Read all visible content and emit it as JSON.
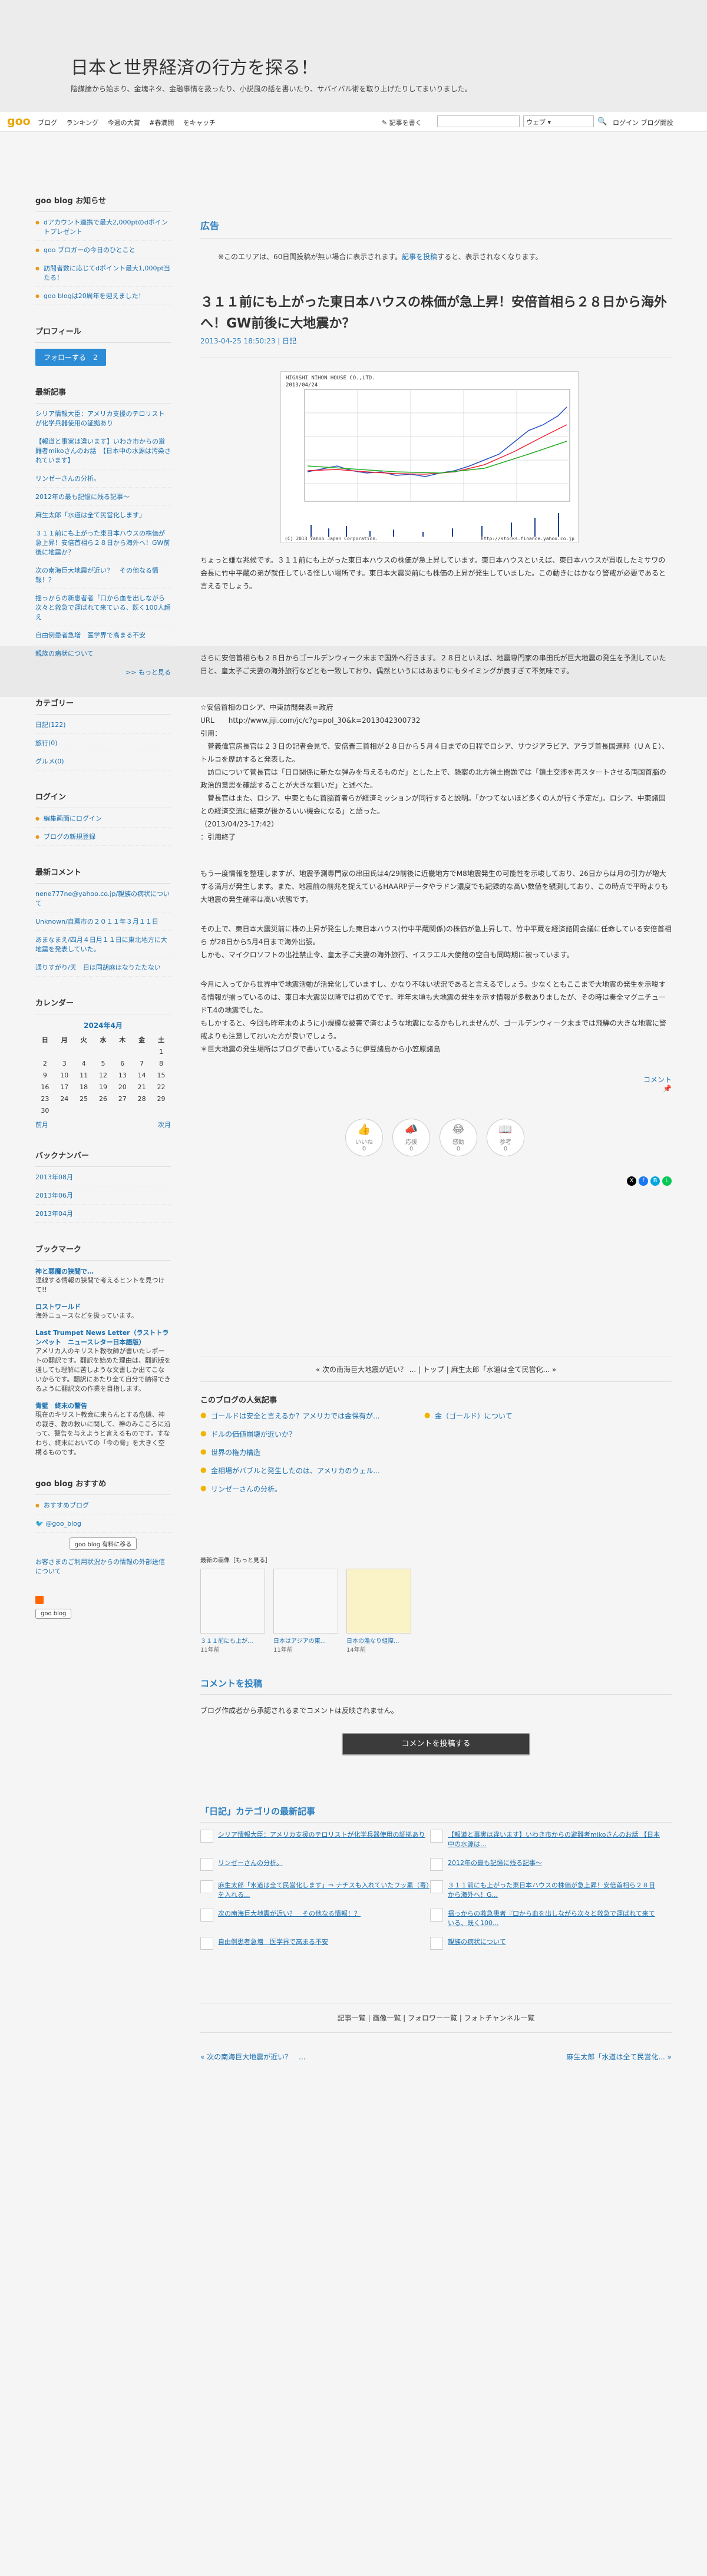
{
  "header": {
    "blog_title": "日本と世界経済の行方を探る！",
    "description": "陰謀論から始まり、金塊ネタ、金融事情を扱ったり、小説風の話を書いたり、サバイバル術を取り上げたりしてまいりました。"
  },
  "topbar": {
    "logo": "goo",
    "links": [
      "ブログ",
      "ランキング",
      "今週の大賞",
      "#春満開",
      "をキャッチ"
    ],
    "write": "記事を書く",
    "search_placeholder": "",
    "search_select": "ウェブ",
    "right_links": [
      "ログイン",
      "ブログ開設"
    ]
  },
  "sidebar": {
    "notice": {
      "title": "goo blog お知らせ",
      "items": [
        "dアカウント連携で最大2,000ptのdポイントプレゼント",
        "goo ブロガーの今日のひとこと",
        "訪問者数に応じてdポイント最大1,000pt当たる！",
        "goo blogは20周年を迎えました！"
      ]
    },
    "profile": {
      "title": "プロフィール",
      "follow": "フォローする",
      "count": "2"
    },
    "recent": {
      "title": "最新記事",
      "items": [
        "シリア情報大臣：アメリカ支援のテロリストが化学兵器使用の証拠あり",
        "【報道と事実は違います】いわき市からの避難者mikoさんのお話　【日本中の水源は汚染されています】",
        "リンゼーさんの分析。",
        "2012年の最も記憶に残る記事～",
        "麻生太郎「水道は全て民営化します」",
        "３１１前にも上がった東日本ハウスの株価が急上昇！安倍首相ら２８日から海外へ！GW前後に地震か？",
        "次の南海巨大地震が近い？　その他なる情報！？",
        "揺っからの新息者者「口から血を出しながら次々と救急で運ばれて来ている、既く100人超え",
        "自由例患者急増　医学界で高まる不安",
        "親族の病状について"
      ],
      "more": ">> もっと見る"
    },
    "category": {
      "title": "カテゴリー",
      "items": [
        "日記(122)",
        "旅行(0)",
        "グルメ(0)"
      ]
    },
    "login": {
      "title": "ログイン",
      "items": [
        "編集画面にログイン",
        "ブログの新規登録"
      ]
    },
    "comments": {
      "title": "最新コメント",
      "items": [
        "nene777ne@yahoo.co.jp/親族の病状について",
        "Unknown/自薦市の２０１１年３月１１日",
        "あまなまえ/四月４日月１１日に東北地方に大地震を発表していた。",
        "通りすがり/天　日は同胡麻はなりたたない"
      ]
    },
    "calendar": {
      "title": "カレンダー",
      "month": "2024年4月",
      "weekdays": [
        "日",
        "月",
        "火",
        "水",
        "木",
        "金",
        "土"
      ],
      "prev": "前月",
      "next": "次月"
    },
    "backnumber": {
      "title": "バックナンバー",
      "items": [
        "2013年08月",
        "2013年06月",
        "2013年04月"
      ]
    },
    "bookmark": {
      "title": "ブックマーク",
      "items": [
        {
          "t": "神と悪魔の狭間で…",
          "d": "混線する情報の狭間で考えるヒントを見つけて!!"
        },
        {
          "t": "ロストワールド",
          "d": "海外ニュースなどを扱っています。"
        },
        {
          "t": "Last Trumpet News Letter（ラストトランペット　ニュースレター日本語版）",
          "d": "アメリカ人のキリスト教牧師が書いたレポートの翻訳です。翻訳を始めた理由は、翻訳版を通しても理解に苦しような文書しか出てこないからです。翻訳にあたり全て自分で納得できるように翻訳文の作業を目指します。"
        },
        {
          "t": "青藍　終末の警告",
          "d": "現在のキリスト教会に来らんとする危機、神の裁き、教の救いに関して、神のみこころに沿って、警告を与えようと言えるものです。すなわち、終末においての「今の脅」を大きく空構るものです。"
        }
      ]
    },
    "recommend": {
      "title": "goo blog おすすめ",
      "items": [
        "おすすめブログ",
        "@goo_blog"
      ],
      "badge": "goo blog 有料に移る",
      "guide": "お客さまのご利用状況からの情報の外部送信について"
    },
    "footer_badge": "goo blog"
  },
  "main": {
    "ad_heading": "広告",
    "ad_text_pre": "※このエリアは、60日間投稿が無い場合に表示されます。",
    "ad_link": "記事を投稿",
    "ad_text_post": "すると、表示されなくなります。",
    "entry_title": "３１１前にも上がった東日本ハウスの株価が急上昇！安倍首相ら２８日から海外へ！GW前後に大地震か？",
    "entry_date": "2013-04-25 18:50:23",
    "entry_category": "日記",
    "chart_title": "HIGASHI NIHON HOUSE CO.,LTD.",
    "chart_sub": "2013/04/24",
    "chart_footer": "(C) 2013 Yahoo Japan Corporation.",
    "chart_url": "http://stocks.finance.yahoo.co.jp",
    "paragraphs": [
      "ちょっと嫌な兆候です。３１１前にも上がった東日本ハウスの株価が急上昇しています。東日本ハウスといえば、東日本ハウスが買収したミサワの会長に竹中平蔵の弟が就任している怪しい場所です。東日本大震災前にも株価の上昇が発生していました。この動きにはかなり警戒が必要であると言えるでしょう。",
      "さらに安倍首相らも２８日からゴールデンウィーク末まで国外へ行きます。２８日といえば、地震専門家の串田氏が巨大地震の発生を予測していた日と、皇太子ご夫妻の海外旅行などとも一致しており、偶然というにはあまりにもタイミングが良すぎて不気味です。",
      "☆安倍首相のロシア、中東訪問発表＝政府\nURL　　http://www.jiji.com/jc/c?g=pol_30&k=2013042300732\n引用：\n　菅義偉官房長官は２３日の記者会見で、安倍晋三首相が２８日から５月４日までの日程でロシア、サウジアラビア、アラブ首長国連邦（ＵＡＥ）、トルコを歴訪すると発表した。\n　訪ロについて菅長官は「日ロ関係に新たな弾みを与えるものだ」とした上で、懸案の北方領土問題では「鎖土交渉を再スタートさせる両国首脳の政治的意思を確認することが大きな狙いだ」と述べた。\n　菅長官はまた、ロシア、中東ともに首脳首者らが経済ミッションが同行すると説明。「かつてないほど多くの人が行く予定だ」。ロシア、中東諸国との経済交流に結束が後かるいい機会になる」と語った。\n（2013/04/23-17:42）\n：引用終了",
      "もう一度情報を整理しますが、地震予測専門家の串田氏は4/29前後に近畿地方でM8地震発生の可能性を示唆しており、26日からは月の引力が増大する満月が発生します。また、地震前の前兆を捉えているHAARPデータやラドン濃度でも記録的な高い数値を観測しており、この時点で平時よりも大地震の発生確率は高い状態です。",
      "その上で、東日本大震災前に株の上昇が発生した東日本ハウス(竹中平蔵関係)の株価が急上昇して、竹中平蔵を経済諮問会議に任命している安倍首相ら が28日から5月4日まで海外出張。\nしかも、マイクロソフトの出社禁止令、皇太子ご夫妻の海外旅行、イスラエル大使館の空白も同時期に被っています。",
      "今月に入ってから世界中で地震活動が活発化していますし、かなり不味い状況であると言えるでしょう。少なくともここまで大地震の発生を示唆する情報が揃っているのは、東日本大震災以降では初めてです。昨年末頃も大地震の発生を示す情報が多数ありましたが、その時は奏全マグニチュードT.4の地震でした。\nもしかすると、今回も昨年末のように小規模な被害で済むような地震になるかもしれませんが、ゴールデンウィーク末までは飛騨の大きな地震に警戒よりも注意しておいた方が良いでしょう。\n＊巨大地震の発生場所はブログで書いているように伊豆諸島から小笠原諸島"
    ],
    "comment_link": "コメント",
    "reactions": [
      {
        "label": "いいね",
        "emoji": "👍"
      },
      {
        "label": "応援",
        "emoji": "📣"
      },
      {
        "label": "感動",
        "emoji": "😂"
      },
      {
        "label": "参考",
        "emoji": "📖"
      }
    ],
    "reaction_counts": [
      "0",
      "0",
      "0",
      "0"
    ],
    "pager": "« 次の南海巨大地震が近い？ ... | トップ | 麻生太郎「水道は全て民営化... »",
    "popular_title": "このブログの人気記事",
    "popular": [
      "ゴールドは安全と言えるか？アメリカでは金保有が...",
      "金（ゴールド）について",
      "ドルの価値崩壊が近いか？",
      "",
      "世界の権力構造",
      "",
      "金相場がバブルと発生したのは、アメリカのウェル...",
      "",
      "リンゼーさんの分析。",
      ""
    ],
    "thumbs_title": "最新の画像［もっと見る］",
    "thumbs": [
      {
        "c": "３１１前にも上が...",
        "d": "11年前"
      },
      {
        "c": "日本はアジアの東...",
        "d": "11年前"
      },
      {
        "c": "日本の漁なり組際...",
        "d": "14年前"
      }
    ],
    "comment_post_title": "コメントを投稿",
    "comment_post_text": "ブログ作成者から承認されるまでコメントは反映されません。",
    "comment_button": "コメントを投稿する",
    "category_title": "「日記」カテゴリの最新記事",
    "category_items": [
      "シリア情報大臣：アメリカ支援のテロリストが化学兵器使用の証拠あり",
      "【報道と事実は違います】いわき市からの避難者mikoさんのお話 【日本中の水源は...",
      "リンゼーさんの分析。",
      "2012年の最も記憶に残る記事～",
      "麻生太郎「水道は全て民営化します」⇒ ナチスも入れていたフッ素（毒）を入れる...",
      "３１１前にも上がった東日本ハウスの株価が急上昇！安倍首相ら２８日から海外へ！G...",
      "次の南海巨大地震が近い？　その他なる情報！？",
      "揺っからの救急患者『口から血を出しながら次々と救急で運ばれて来ている、既く100...",
      "自由例患者急増　医学界で高まる不安",
      "親族の病状について"
    ],
    "footer_links": "記事一覧 | 画像一覧 | フォロワー一覧 | フォトチャンネル一覧",
    "footer_prev": "« 次の南海巨大地震が近い？　...",
    "footer_next": "麻生太郎「水道は全て民営化... »"
  }
}
